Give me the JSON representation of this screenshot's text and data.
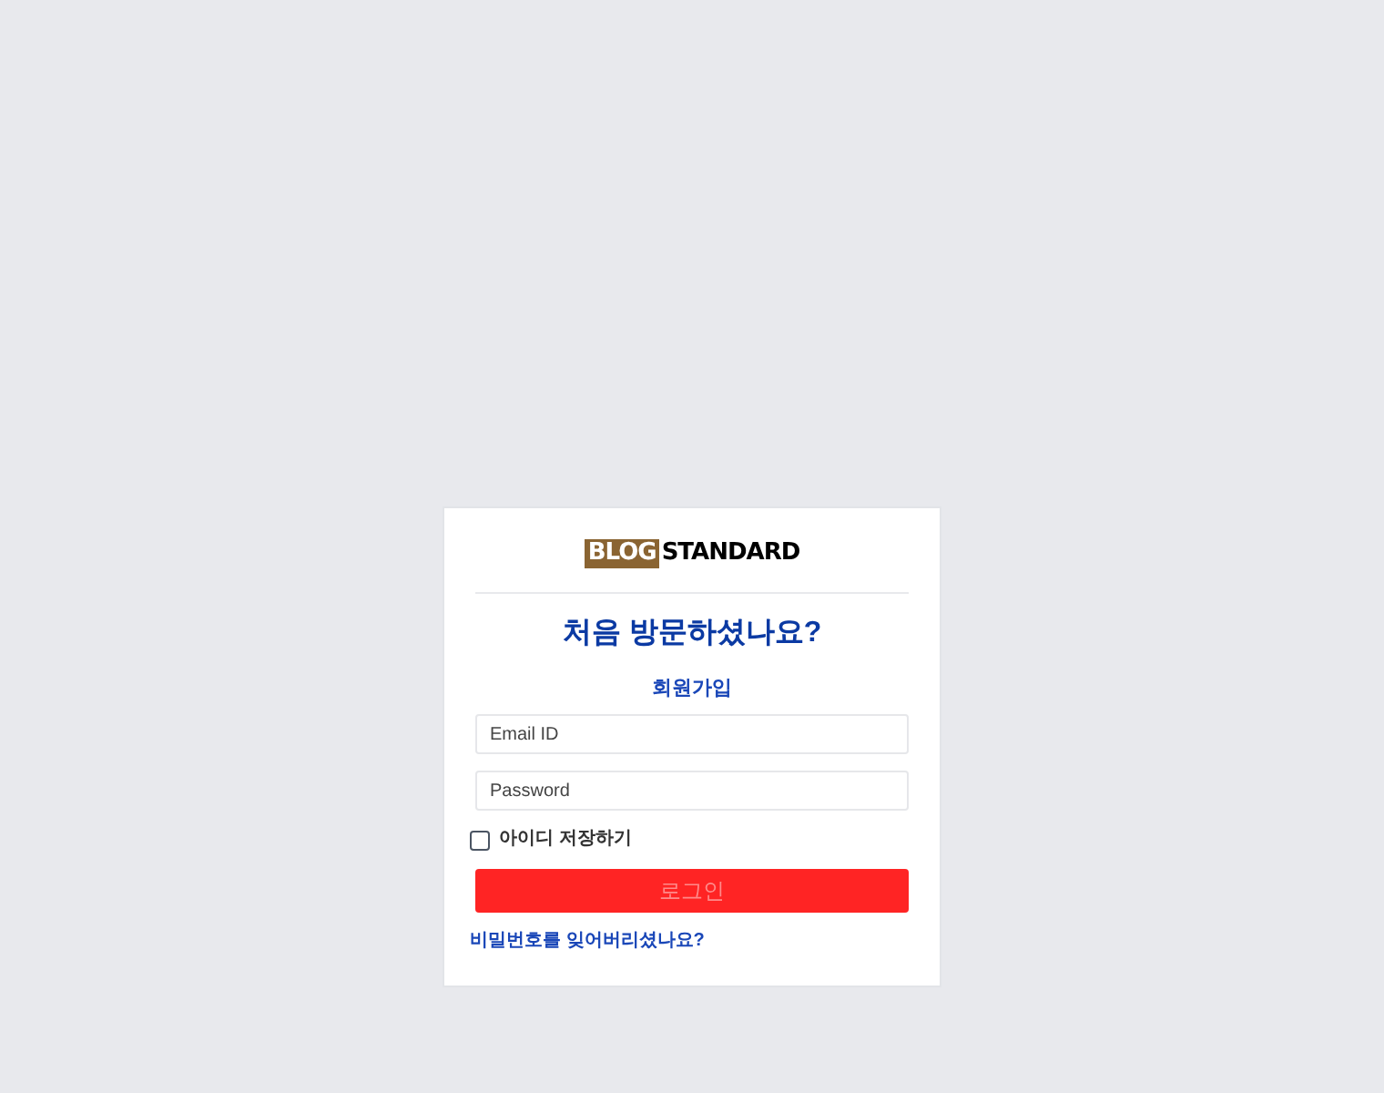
{
  "logo": {
    "part_1": "BLOG",
    "part_2": "STANDARD"
  },
  "heading": "처음 방문하셨나요?",
  "signup_link": "회원가입",
  "email": {
    "placeholder": "Email ID"
  },
  "password": {
    "placeholder": "Password"
  },
  "remember": {
    "label": "아이디 저장하기",
    "checked": false
  },
  "login_button": "로그인",
  "forgot_link": "비밀번호를 잊어버리셨나요?"
}
